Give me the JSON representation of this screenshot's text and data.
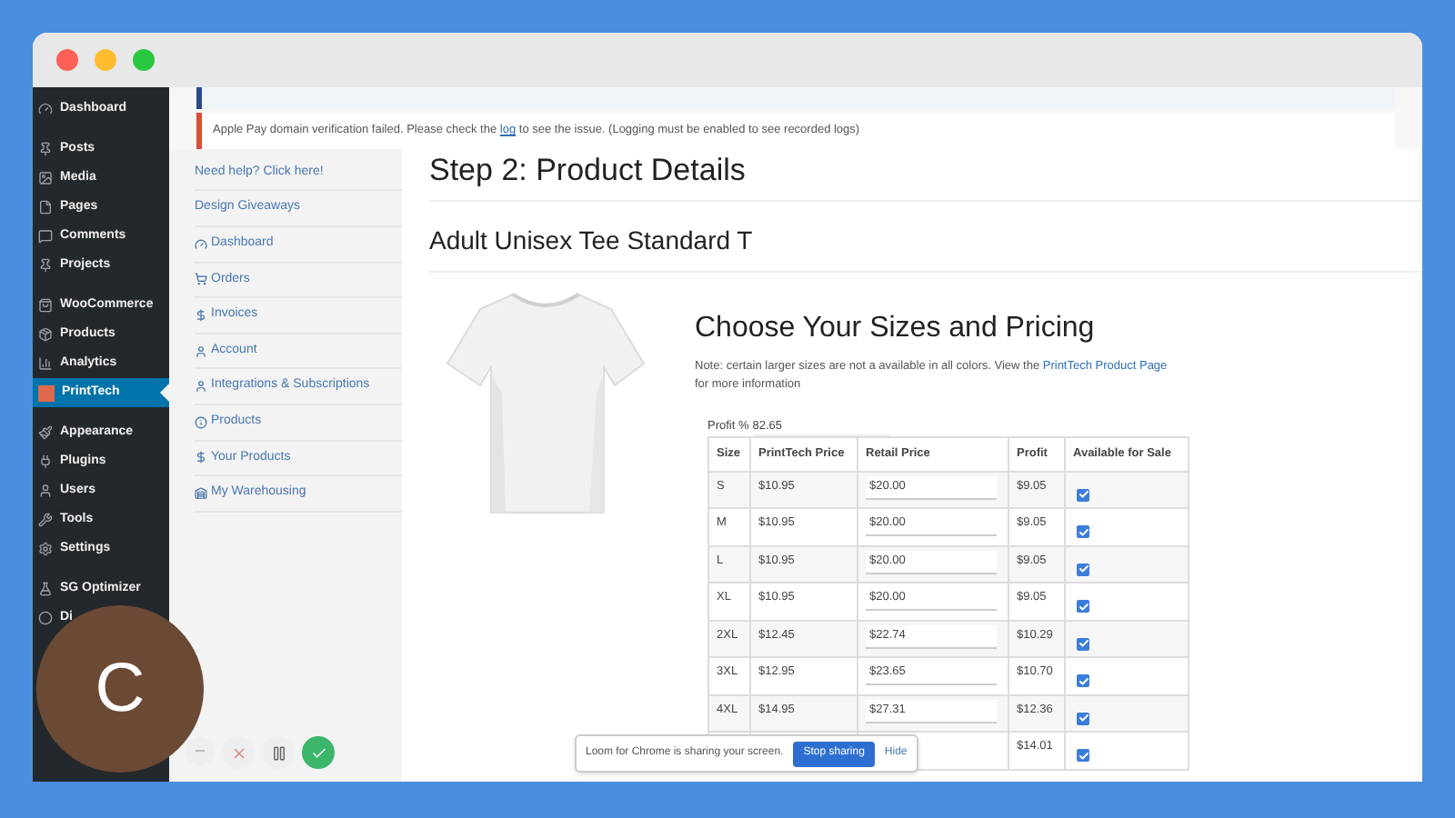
{
  "wp_menu": [
    {
      "label": "Dashboard",
      "selected": false
    },
    {
      "label": "Posts",
      "selected": false
    },
    {
      "label": "Media",
      "selected": false
    },
    {
      "label": "Pages",
      "selected": false
    },
    {
      "label": "Comments",
      "selected": false
    },
    {
      "label": "Projects",
      "selected": false
    },
    {
      "label": "WooCommerce",
      "selected": false
    },
    {
      "label": "Products",
      "selected": false
    },
    {
      "label": "Analytics",
      "selected": false
    },
    {
      "label": "PrintTech",
      "selected": true
    },
    {
      "label": "Appearance",
      "selected": false
    },
    {
      "label": "Plugins",
      "selected": false
    },
    {
      "label": "Users",
      "selected": false
    },
    {
      "label": "Tools",
      "selected": false
    },
    {
      "label": "Settings",
      "selected": false
    },
    {
      "label": "SG Optimizer",
      "selected": false
    },
    {
      "label": "Di",
      "selected": false
    }
  ],
  "notice": {
    "before": "Apple Pay domain verification failed. Please check the ",
    "link": "log",
    "after": " to see the issue. (Logging must be enabled to see recorded logs)"
  },
  "plugin_menu": [
    {
      "label": "Need help? Click here!"
    },
    {
      "label": "Design Giveaways"
    },
    {
      "label": "Dashboard"
    },
    {
      "label": "Orders"
    },
    {
      "label": "Invoices"
    },
    {
      "label": "Account"
    },
    {
      "label": "Integrations & Subscriptions"
    },
    {
      "label": "Products"
    },
    {
      "label": "Your Products"
    },
    {
      "label": "My Warehousing"
    }
  ],
  "page_title": "Step 2: Product Details",
  "product_title": "Adult Unisex Tee Standard T",
  "pricing": {
    "title": "Choose Your Sizes and Pricing",
    "note_before": "Note: certain larger sizes are not a available in all colors. View the ",
    "note_link": "PrintTech Product Page",
    "note_after": " for more information",
    "profit_label": "Profit %",
    "profit_value": "82.65",
    "columns": [
      "Size",
      "PrintTech Price",
      "Retail Price",
      "Profit",
      "Available for Sale"
    ],
    "rows": [
      {
        "size": "S",
        "price": "$10.95",
        "retail": "$20.00",
        "profit": "$9.05",
        "checked": true
      },
      {
        "size": "M",
        "price": "$10.95",
        "retail": "$20.00",
        "profit": "$9.05",
        "checked": true
      },
      {
        "size": "L",
        "price": "$10.95",
        "retail": "$20.00",
        "profit": "$9.05",
        "checked": true
      },
      {
        "size": "XL",
        "price": "$10.95",
        "retail": "$20.00",
        "profit": "$9.05",
        "checked": true
      },
      {
        "size": "2XL",
        "price": "$12.45",
        "retail": "$22.74",
        "profit": "$10.29",
        "checked": true
      },
      {
        "size": "3XL",
        "price": "$12.95",
        "retail": "$23.65",
        "profit": "$10.70",
        "checked": true
      },
      {
        "size": "4XL",
        "price": "$14.95",
        "retail": "$27.31",
        "profit": "$12.36",
        "checked": true
      },
      {
        "profit": "$14.01",
        "checked": true
      }
    ]
  },
  "share_bar": {
    "message": "Loom for Chrome is sharing your screen.",
    "stop": "Stop sharing",
    "hide": "Hide"
  },
  "camera": {
    "initial": "C"
  }
}
